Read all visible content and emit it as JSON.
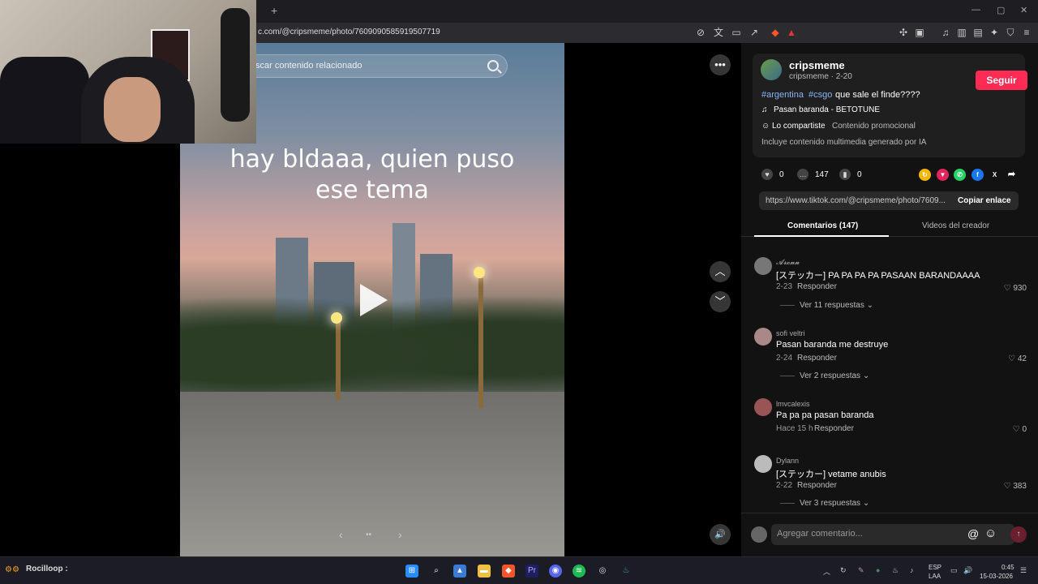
{
  "browser": {
    "url": "c.com/@cripsmeme/photo/7609090585919507719",
    "new_tab_label": "+",
    "window_controls": [
      "—",
      "▢",
      "✕"
    ]
  },
  "video": {
    "search_placeholder": "scar contenido relacionado",
    "overlay_text_line1": "hay bldaaa, quien puso",
    "overlay_text_line2": "ese tema",
    "more_label": "•••",
    "up_label": "︿",
    "down_label": "﹀",
    "volume_label": "🔊",
    "carousel_prev": "‹",
    "carousel_dots": "••",
    "carousel_next": "›"
  },
  "creator": {
    "name": "cripsmeme",
    "handle_date": "cripsmeme · 2-20",
    "follow_label": "Seguir",
    "tag1": "#argentina",
    "tag2": "#csgo",
    "caption": "que sale el finde????",
    "music": "Pasan baranda - BETOTUNE",
    "shared_label": "Lo compartiste",
    "promo_label": "Contenido promocional",
    "ai_label": "Incluye contenido multimedia generado por IA"
  },
  "stats": {
    "likes": "0",
    "comments": "147",
    "saves": "0"
  },
  "link": {
    "url": "https://www.tiktok.com/@cripsmeme/photo/7609...",
    "copy_label": "Copiar enlace"
  },
  "tabs": {
    "comments": "Comentarios (147)",
    "creator_videos": "Videos del creador"
  },
  "comments": [
    {
      "name": "𝓐𝓻𝓸𝓷𝓷",
      "text": "[ステッカー] PA PA PA PA PASAAN BARANDAAAA",
      "date": "2-23",
      "reply": "Responder",
      "likes": "930",
      "more": "Ver 11 respuestas ⌄"
    },
    {
      "name": "sofi veltri",
      "text": "Pasan baranda me destruye",
      "date": "2-24",
      "reply": "Responder",
      "likes": "42",
      "more": "Ver 2 respuestas ⌄"
    },
    {
      "name": "lmvcalexis",
      "text": "Pa pa pa pasan baranda",
      "date": "Hace 15 h",
      "reply": "Responder",
      "likes": "0",
      "more": ""
    },
    {
      "name": "Dylann",
      "text": "[ステッカー] vetame anubis",
      "date": "2-22",
      "reply": "Responder",
      "likes": "383",
      "more": "Ver 3 respuestas ⌄"
    }
  ],
  "comment_input": {
    "placeholder": "Agregar comentario...",
    "mention": "@",
    "emoji": "☺",
    "send": "↑"
  },
  "stream_overlay": {
    "chat_user": "Rocilloop :"
  },
  "taskbar": {
    "lang1": "ESP",
    "lang2": "LAA",
    "time": "0:45",
    "date": "15-03-2026"
  },
  "colors": {
    "accent": "#fe2c55",
    "hashtag": "#8ab4f8"
  }
}
